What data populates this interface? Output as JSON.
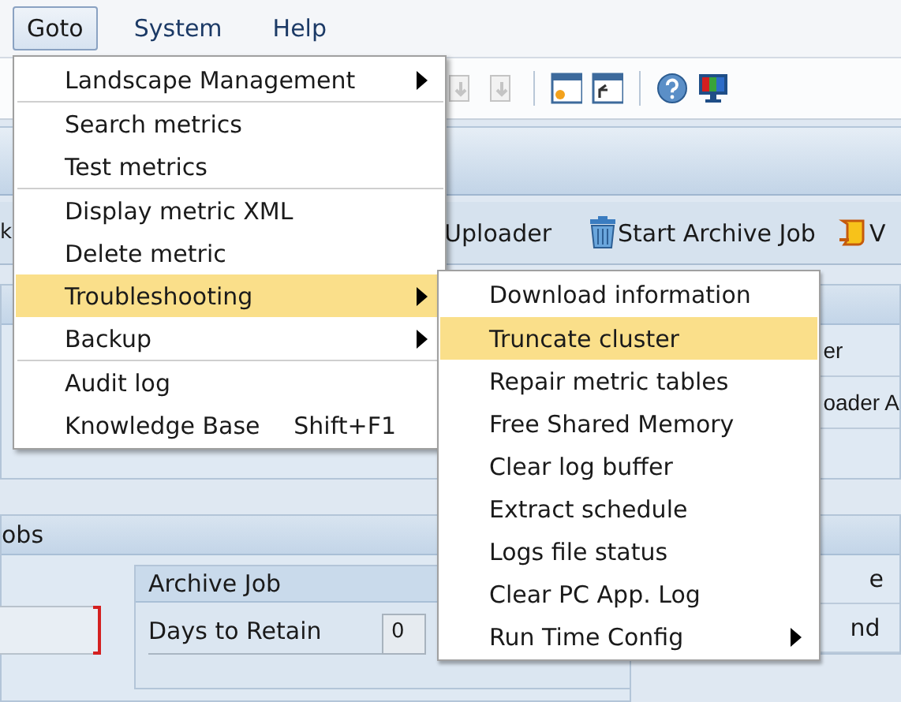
{
  "menu_bar": [
    {
      "label": "Goto",
      "selected": true
    },
    {
      "label": "System",
      "selected": false
    },
    {
      "label": "Help",
      "selected": false
    }
  ],
  "toolbar": {
    "icons": [
      {
        "kind": "page-disabled"
      },
      {
        "kind": "page-disabled"
      },
      {
        "kind": "separator"
      },
      {
        "kind": "window-star"
      },
      {
        "kind": "window-arrow"
      },
      {
        "kind": "separator"
      },
      {
        "kind": "help"
      },
      {
        "kind": "monitor"
      }
    ]
  },
  "application_toolbar": {
    "buttons": [
      {
        "label": "k",
        "kind": "text"
      },
      {
        "label": "Uploader",
        "kind": "text"
      },
      {
        "label": "Start Archive Job",
        "kind": "trash"
      },
      {
        "label": "V",
        "kind": "scroll"
      }
    ]
  },
  "content": {
    "right_top_panel": {
      "rows": [
        "er",
        "oader A"
      ]
    },
    "jobs_section": {
      "title": "obs",
      "archive_job": {
        "title": "Archive Job",
        "days_to_retain": {
          "label": "Days to Retain",
          "value": "0"
        }
      },
      "right_rows": [
        "e",
        "nd"
      ]
    }
  },
  "goto_menu": {
    "items": [
      {
        "kind": "item",
        "label": "Landscape Management",
        "submenu": true,
        "selected": false
      },
      {
        "kind": "separator"
      },
      {
        "kind": "item",
        "label": "Search metrics",
        "submenu": false,
        "selected": false
      },
      {
        "kind": "item",
        "label": "Test metrics",
        "submenu": false,
        "selected": false
      },
      {
        "kind": "separator"
      },
      {
        "kind": "item",
        "label": "Display metric XML",
        "submenu": false,
        "selected": false
      },
      {
        "kind": "item",
        "label": "Delete metric",
        "submenu": false,
        "selected": false
      },
      {
        "kind": "item",
        "label": "Troubleshooting",
        "submenu": true,
        "selected": true
      },
      {
        "kind": "item",
        "label": "Backup",
        "submenu": true,
        "selected": false
      },
      {
        "kind": "separator"
      },
      {
        "kind": "item",
        "label": "Audit log",
        "submenu": false,
        "selected": false
      },
      {
        "kind": "item",
        "label": "Knowledge Base",
        "submenu": false,
        "selected": false,
        "shortcut": "Shift+F1"
      }
    ]
  },
  "troubleshooting_submenu": {
    "items": [
      {
        "kind": "item",
        "label": "Download information",
        "submenu": false,
        "selected": false
      },
      {
        "kind": "separator"
      },
      {
        "kind": "item",
        "label": "Truncate cluster",
        "submenu": false,
        "selected": true
      },
      {
        "kind": "item",
        "label": "Repair metric tables",
        "submenu": false,
        "selected": false
      },
      {
        "kind": "item",
        "label": "Free Shared Memory",
        "submenu": false,
        "selected": false
      },
      {
        "kind": "item",
        "label": "Clear log buffer",
        "submenu": false,
        "selected": false
      },
      {
        "kind": "item",
        "label": "Extract schedule",
        "submenu": false,
        "selected": false
      },
      {
        "kind": "item",
        "label": "Logs file status",
        "submenu": false,
        "selected": false
      },
      {
        "kind": "item",
        "label": "Clear PC App. Log",
        "submenu": false,
        "selected": false
      },
      {
        "kind": "item",
        "label": "Run Time Config",
        "submenu": true,
        "selected": false
      }
    ]
  }
}
